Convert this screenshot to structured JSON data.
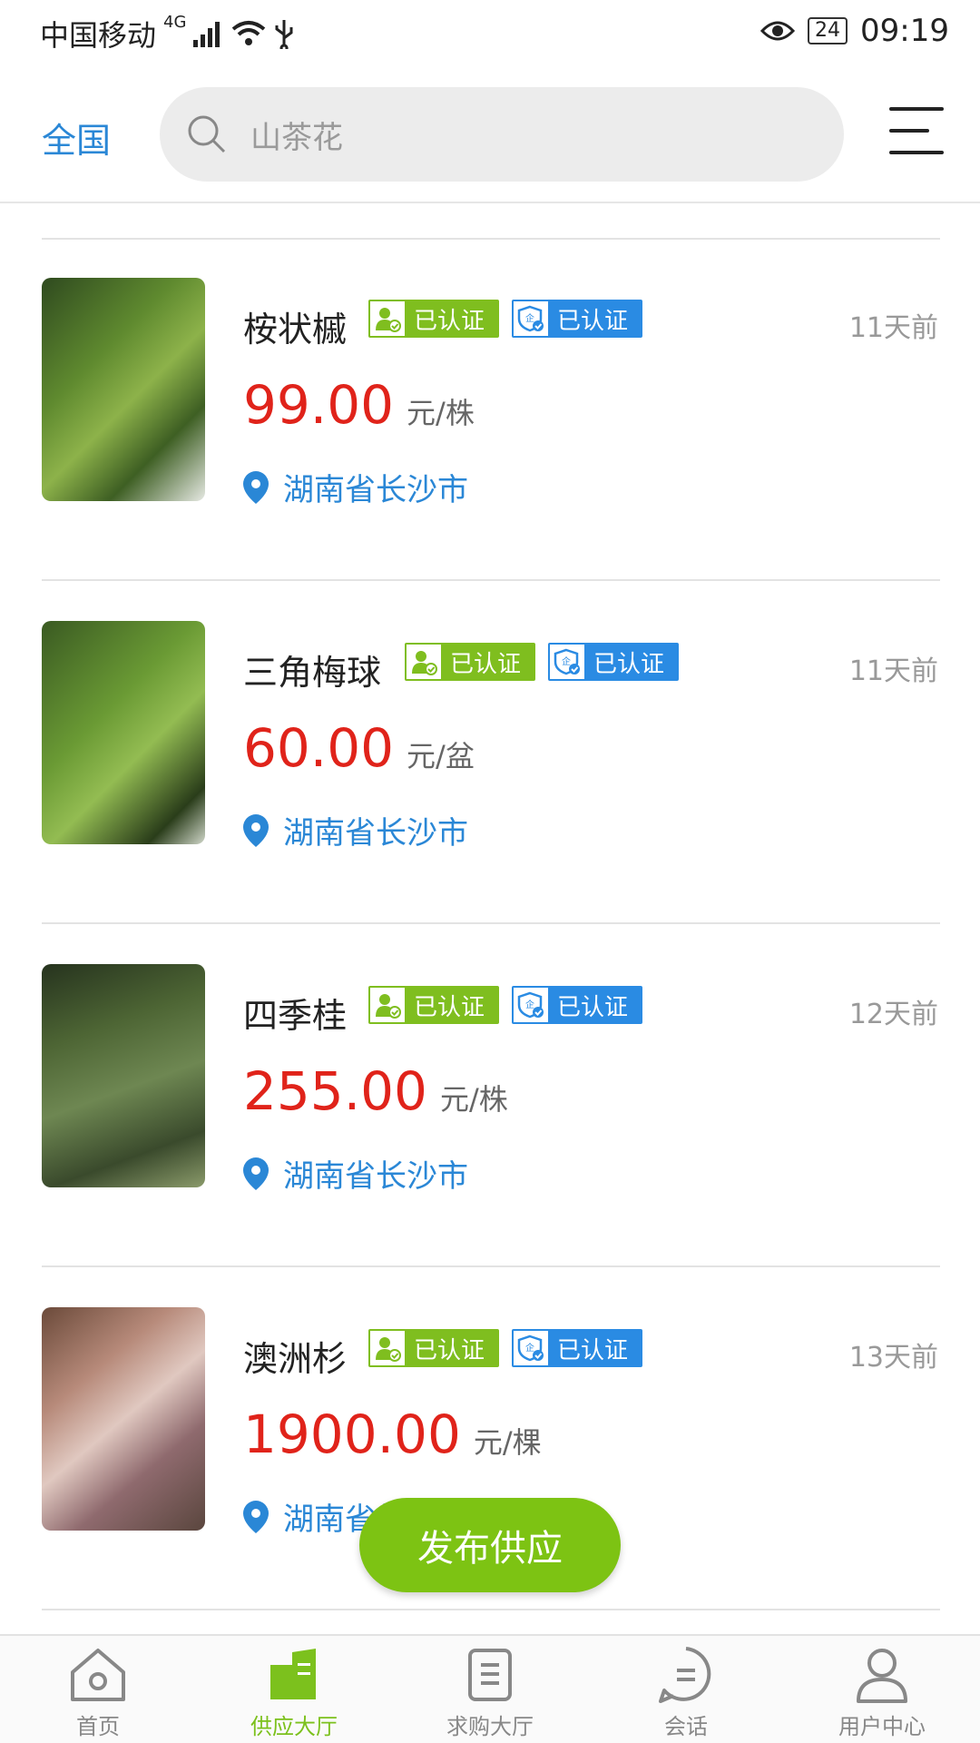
{
  "status_bar": {
    "carrier": "中国移动",
    "network": "4G",
    "battery": "24",
    "time": "09:19"
  },
  "header": {
    "region": "全国",
    "search_placeholder": "山茶花"
  },
  "items": [
    {
      "name": "桉状槭",
      "badge_person": "已认证",
      "badge_company": "已认证",
      "time": "11天前",
      "price": "99.00",
      "unit": "元/株",
      "location": "湖南省长沙市"
    },
    {
      "name": "三角梅球",
      "badge_person": "已认证",
      "badge_company": "已认证",
      "time": "11天前",
      "price": "60.00",
      "unit": "元/盆",
      "location": "湖南省长沙市"
    },
    {
      "name": "四季桂",
      "badge_person": "已认证",
      "badge_company": "已认证",
      "time": "12天前",
      "price": "255.00",
      "unit": "元/株",
      "location": "湖南省长沙市"
    },
    {
      "name": "澳洲杉",
      "badge_person": "已认证",
      "badge_company": "已认证",
      "time": "13天前",
      "price": "1900.00",
      "unit": "元/棵",
      "location": "湖南省长沙市"
    }
  ],
  "publish_button": "发布供应",
  "tabs": [
    {
      "label": "首页",
      "icon": "home-icon"
    },
    {
      "label": "供应大厅",
      "icon": "supply-hall-icon"
    },
    {
      "label": "求购大厅",
      "icon": "purchase-hall-icon"
    },
    {
      "label": "会话",
      "icon": "chat-icon"
    },
    {
      "label": "用户中心",
      "icon": "user-icon"
    }
  ],
  "colors": {
    "accent_green": "#7dc313",
    "link_blue": "#2a87d6",
    "price_red": "#e0231a",
    "badge_blue": "#2a8be3"
  }
}
